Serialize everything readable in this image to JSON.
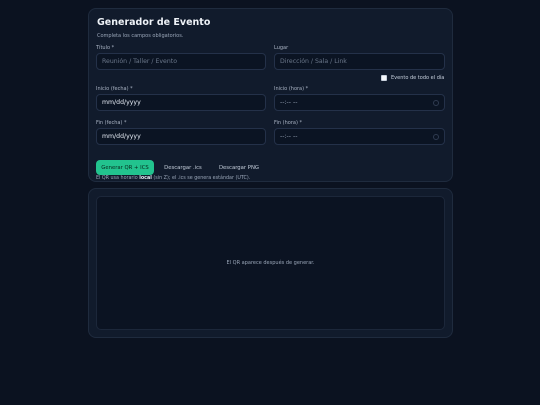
{
  "form": {
    "title": "Generador de Evento",
    "subtitle": "Completa los campos obligatorios.",
    "titulo_label": "Título *",
    "titulo_placeholder": "Reunión / Taller / Evento",
    "lugar_label": "Lugar",
    "lugar_placeholder": "Dirección / Sala / Link",
    "all_day_label": "Evento de todo el día",
    "inicio_fecha_label": "Inicio (fecha) *",
    "inicio_fecha_value": "mm/dd/yyyy",
    "inicio_hora_label": "Inicio (hora) *",
    "inicio_hora_value": "--:-- --",
    "fin_fecha_label": "Fin (fecha) *",
    "fin_fecha_value": "mm/dd/yyyy",
    "fin_hora_label": "Fin (hora) *",
    "fin_hora_value": "--:-- --",
    "generate_button": "Generar QR + ICS",
    "download_ics_button": "Descargar .ics",
    "download_png_button": "Descargar PNG",
    "note_prefix": "El QR usa horario ",
    "note_bold": "local",
    "note_suffix": " (sin Z); el .ics se genera estándar (UTC)."
  },
  "qr": {
    "placeholder": "El QR aparece después de generar."
  },
  "colors": {
    "background": "#0b1220",
    "card": "#111b2c",
    "accent": "#22c38e"
  }
}
